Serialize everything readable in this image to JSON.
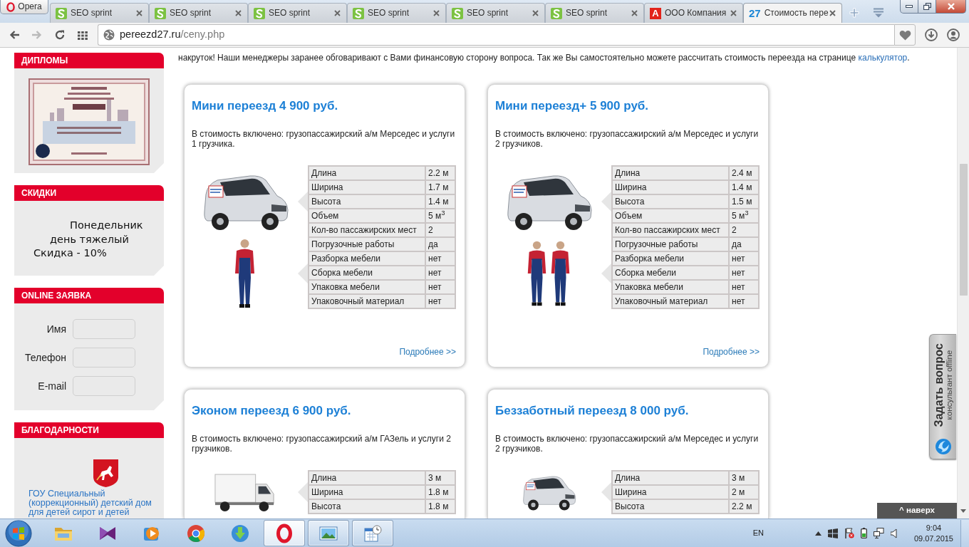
{
  "browser": {
    "menu_button": "Opera",
    "tabs": [
      {
        "title": "SEO sprint",
        "kind": "sprint",
        "selected": false
      },
      {
        "title": "SEO sprint",
        "kind": "sprint",
        "selected": false
      },
      {
        "title": "SEO sprint",
        "kind": "sprint",
        "selected": false
      },
      {
        "title": "SEO sprint",
        "kind": "sprint",
        "selected": false
      },
      {
        "title": "SEO sprint",
        "kind": "sprint",
        "selected": false
      },
      {
        "title": "SEO sprint",
        "kind": "sprint",
        "selected": false
      },
      {
        "title": "ООО Компания",
        "kind": "letter",
        "favicon_text": "A",
        "selected": false
      },
      {
        "title": "Стоимость пере",
        "kind": "number",
        "favicon_text": "27",
        "selected": true
      }
    ],
    "nav_buttons": [
      {
        "kind": "back",
        "disabled": false
      },
      {
        "kind": "forward",
        "disabled": true
      },
      {
        "kind": "reload",
        "disabled": false
      },
      {
        "kind": "speed-dial",
        "disabled": false
      }
    ],
    "address": {
      "domain": "pereezd27.ru",
      "path": "/ceny.php"
    }
  },
  "sidebar": [
    {
      "title": "ДИПЛОМЫ",
      "kind": "image"
    },
    {
      "title": "СКИДКИ",
      "kind": "text",
      "lines": [
        "Понедельник",
        "день тяжелый",
        "Скидка - 10%"
      ]
    },
    {
      "title": "ONLINE ЗАЯВКА",
      "kind": "form",
      "fields": [
        {
          "label": "Имя"
        },
        {
          "label": "Телефон"
        },
        {
          "label": "E-mail"
        }
      ]
    },
    {
      "title": "БЛАГОДАРНОСТИ",
      "kind": "links",
      "items": [
        {
          "text": "ГОУ Специальный (коррекционный) детский дом для детей сирот и детей"
        }
      ]
    }
  ],
  "intro": {
    "text": "накруток! Наши менеджеры заранее обговаривают с Вами финансовую сторону вопроса. Так же Вы самостоятельно можете рассчитать стоимость переезда на странице",
    "link": "калькулятор",
    "tail": "."
  },
  "offers": [
    {
      "title": "Мини переезд 4 900 руб.",
      "description": "В стоимость включено: грузопассажирский а/м Мерседес и услуги 1 грузчика.",
      "images": [
        {
          "kind": "van"
        },
        {
          "kind": "mover"
        }
      ],
      "specs": [
        {
          "name": "Длина",
          "value": "2.2 м"
        },
        {
          "name": "Ширина",
          "value": "1.7 м"
        },
        {
          "name": "Высота",
          "value": "1.4 м"
        },
        {
          "name": "Объем",
          "value": "5 м$^{3}$"
        },
        {
          "name": "Кол-во пассажирских мест",
          "value": "2"
        },
        {
          "name": "Погрузочные работы",
          "value": "да"
        },
        {
          "name": "Разборка мебели",
          "value": "нет"
        },
        {
          "name": "Сборка мебели",
          "value": "нет"
        },
        {
          "name": "Упаковка мебели",
          "value": "нет"
        },
        {
          "name": "Упаковочный материал",
          "value": "нет"
        }
      ],
      "more": "Подробнее >>"
    },
    {
      "title": "Мини переезд+ 5 900 руб.",
      "description": "В стоимость включено: грузопассажирский а/м Мерседес и услуги 2 грузчиков.",
      "images": [
        {
          "kind": "van"
        },
        {
          "kind": "two-movers"
        }
      ],
      "specs": [
        {
          "name": "Длина",
          "value": "2.4 м"
        },
        {
          "name": "Ширина",
          "value": "1.4 м"
        },
        {
          "name": "Высота",
          "value": "1.5 м"
        },
        {
          "name": "Объем",
          "value": "5 м$^{3}$"
        },
        {
          "name": "Кол-во пассажирских мест",
          "value": "2"
        },
        {
          "name": "Погрузочные работы",
          "value": "да"
        },
        {
          "name": "Разборка мебели",
          "value": "нет"
        },
        {
          "name": "Сборка мебели",
          "value": "нет"
        },
        {
          "name": "Упаковка мебели",
          "value": "нет"
        },
        {
          "name": "Упаковочный материал",
          "value": "нет"
        }
      ],
      "more": "Подробнее >>"
    },
    {
      "title": "Эконом переезд 6 900 руб.",
      "description": "В стоимость включено: грузопассажирский а/м ГАЗель и услуги 2 грузчиков.",
      "images": [
        {
          "kind": "box-truck"
        }
      ],
      "specs": [
        {
          "name": "Длина",
          "value": "3 м"
        },
        {
          "name": "Ширина",
          "value": "1.8 м"
        },
        {
          "name": "Высота",
          "value": "1.8 м"
        }
      ]
    },
    {
      "title": "Беззаботный переезд 8 000 руб.",
      "description": "В стоимость включено: грузопассажирский а/м Мерседес и услуги 2 грузчиков.",
      "images": [
        {
          "kind": "van"
        }
      ],
      "specs": [
        {
          "name": "Длина",
          "value": "3 м"
        },
        {
          "name": "Ширина",
          "value": "2 м"
        },
        {
          "name": "Высота",
          "value": "2.2 м"
        }
      ]
    }
  ],
  "consultant": {
    "title": "Задать вопрос",
    "status": "консультант offline"
  },
  "to_top": "^ наверх",
  "taskbar": {
    "apps": [
      {
        "kind": "folder",
        "running": false,
        "selected": false
      },
      {
        "kind": "bowtie",
        "running": false,
        "selected": false
      },
      {
        "kind": "player",
        "running": false,
        "selected": false
      },
      {
        "kind": "browser-circle",
        "running": false,
        "selected": false
      },
      {
        "kind": "download",
        "running": false,
        "selected": false
      },
      {
        "kind": "ring",
        "running": true,
        "selected": true
      },
      {
        "kind": "picture",
        "running": true,
        "selected": false
      },
      {
        "kind": "calendar",
        "running": true,
        "selected": false
      }
    ],
    "language": "EN",
    "time": "9:04",
    "date": "09.07.2015"
  }
}
